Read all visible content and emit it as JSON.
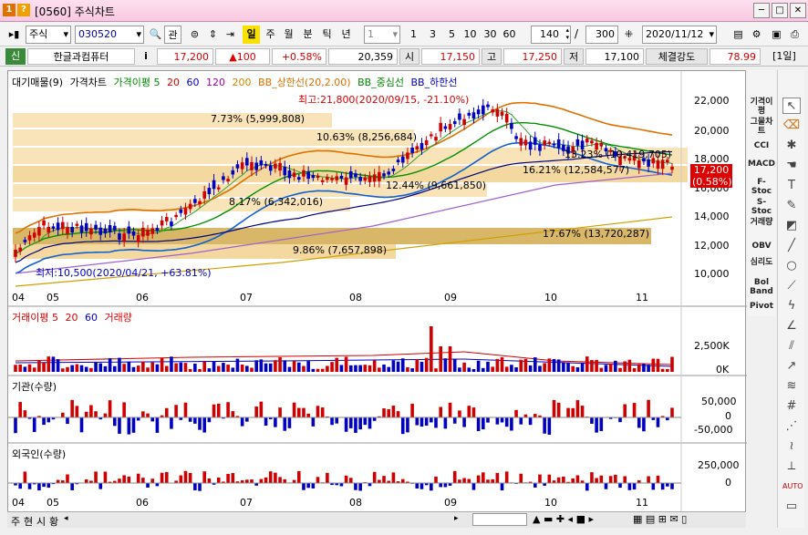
{
  "window": {
    "title_code": "[0560]",
    "title": "주식차트",
    "icon1": "1",
    "icon2": "?"
  },
  "toolbar": {
    "market": "주식",
    "code": "030520",
    "search_btn": "관",
    "period_btns": [
      "일",
      "주",
      "월",
      "분",
      "틱",
      "년"
    ],
    "interval_select": "1",
    "interval_btns": [
      "1",
      "3",
      "5",
      "10",
      "30",
      "60"
    ],
    "count": "140",
    "total": "300",
    "date": "2020/11/12"
  },
  "quote": {
    "flag": "신",
    "name": "한글과컴퓨터",
    "info": "i",
    "price": "17,200",
    "change": "▲100",
    "change_pct": "+0.58%",
    "volume": "20,359",
    "open_label": "시",
    "open": "17,150",
    "high_label": "고",
    "high": "17,250",
    "low_label": "저",
    "low": "17,100",
    "strength_label": "체결강도",
    "strength": "78.99",
    "period": "[1일]"
  },
  "legend": {
    "main": [
      "대기매물(9)",
      "가격차트",
      "가격이평 5",
      "20",
      "60",
      "120",
      "200",
      "BB_상한선(20,2.00)",
      "BB_중심선",
      "BB_하한선"
    ],
    "volume": [
      "거래이평 5",
      "20",
      "60",
      "거래량"
    ],
    "inst": "기관(수량)",
    "foreign": "외국인(수량)"
  },
  "annotations": {
    "high": "최고:21,800(2020/09/15, -21.10%)",
    "low": "최저:10,500(2020/04/21, +63.81%)",
    "current_price": "17,200",
    "current_pct": "(0.58%)",
    "bands": [
      "7.73% (5,999,808)",
      "10.63% (8,256,684)",
      "13.23% (10,419,705)",
      "16.21% (12,584,577)",
      "12.44% (9,661,850)",
      "8.17% (6,342,016)",
      "17.67% (13,720,287)",
      "9.86% (7,657,898)"
    ]
  },
  "axes": {
    "price_ticks": [
      "22,000",
      "20,000",
      "18,000",
      "16,000",
      "14,000",
      "12,000",
      "10,000"
    ],
    "volume_ticks": [
      "2,500K",
      "0K"
    ],
    "inst_ticks": [
      "50,000",
      "0",
      "-50,000"
    ],
    "foreign_ticks": [
      "250,000",
      "0"
    ],
    "months": [
      "04",
      "05",
      "06",
      "07",
      "08",
      "09",
      "10",
      "11"
    ]
  },
  "right_tools": [
    "기격이평",
    "그물차트",
    "CCI",
    "MACD",
    "F-Stoc",
    "S-Stoc",
    "거래량",
    "OBV",
    "심리도",
    "Bol Band",
    "Pivot"
  ],
  "bottom_tabs": [
    "주",
    "현",
    "시",
    "황"
  ],
  "colors": {
    "up": "#d00000",
    "down": "#0000c0",
    "bb": "#e07000",
    "band": "#f5deb0",
    "band_dark": "#c8a860"
  }
}
